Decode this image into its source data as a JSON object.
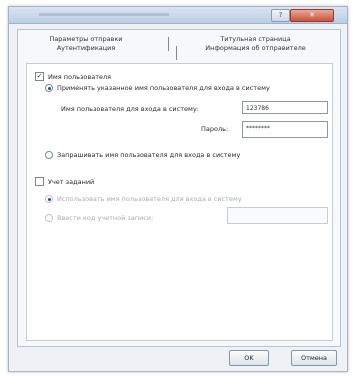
{
  "window": {
    "title": ""
  },
  "titlebar_buttons": {
    "help": "?",
    "close": "✕"
  },
  "tabs": [
    {
      "label": "Параметры отправки"
    },
    {
      "label": "Аутентификация"
    },
    {
      "label": "Титульная страница"
    },
    {
      "label": "Информация об отправителе"
    }
  ],
  "auth": {
    "username_checkbox": {
      "label": "Имя пользователя",
      "checked": true
    },
    "use_specified": {
      "label": "Применять указанное имя пользователя для входа в систему",
      "selected": true
    },
    "login_name": {
      "label": "Имя пользователя для входа в систему:",
      "value": "123786"
    },
    "password": {
      "label": "Пароль:",
      "value": "********"
    },
    "prompt_name": {
      "label": "Запрашивать имя пользователя для входа в систему",
      "selected": false
    }
  },
  "jobs": {
    "job_accounting_checkbox": {
      "label": "Учет заданий",
      "checked": false
    },
    "use_login_name": {
      "label": "Использовать имя пользователя для входа в систему",
      "enabled": false
    },
    "account_code": {
      "label": "Ввести код учетной записи:",
      "value": "",
      "enabled": false
    }
  },
  "footer": {
    "ok": "OK",
    "cancel": "Отмена"
  },
  "colors": {
    "window_bg": "#eef1f5",
    "titlebar": "#bccde3",
    "close_button": "#c9533c"
  },
  "icons": {
    "checkmark": "checkmark-icon",
    "close": "close-icon",
    "help": "help-icon"
  }
}
